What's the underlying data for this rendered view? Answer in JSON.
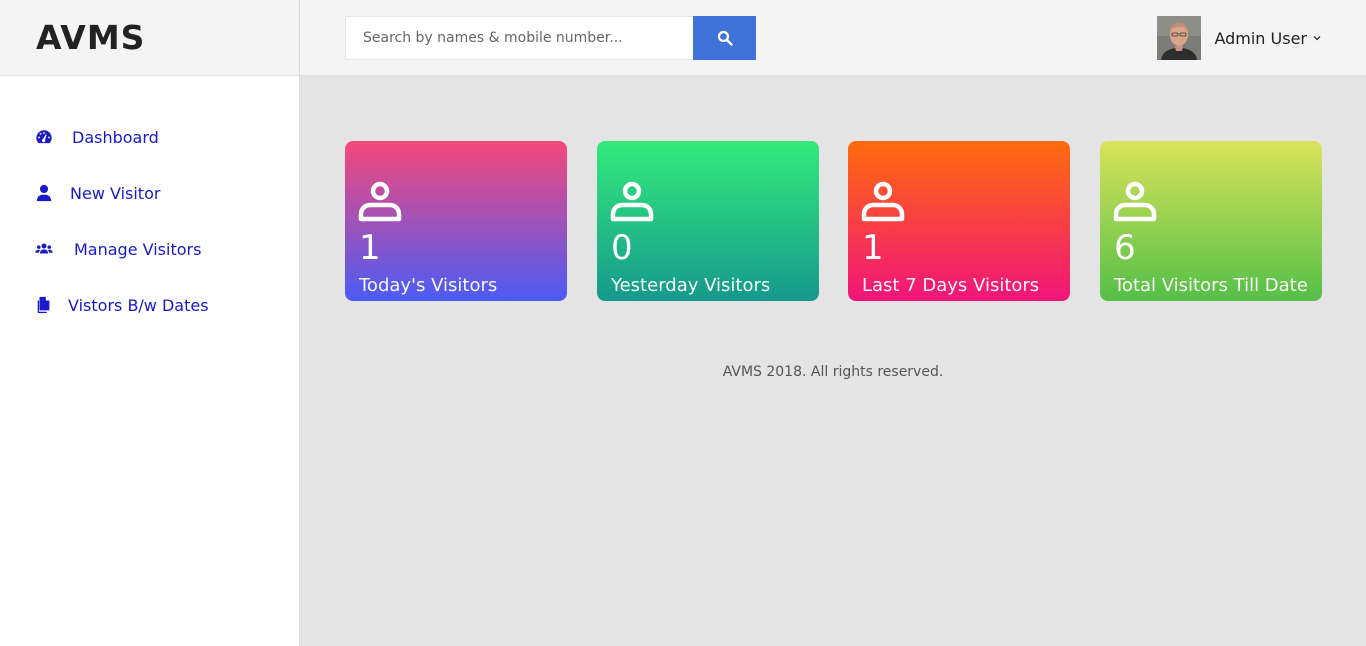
{
  "brand": "AVMS",
  "sidebar": {
    "items": [
      {
        "label": "Dashboard",
        "icon": "dashboard-gauge-icon"
      },
      {
        "label": "New Visitor",
        "icon": "user-icon"
      },
      {
        "label": "Manage Visitors",
        "icon": "users-group-icon"
      },
      {
        "label": "Vistors B/w Dates",
        "icon": "files-icon"
      }
    ]
  },
  "search": {
    "placeholder": "Search by names & mobile number...",
    "value": "",
    "button_icon": "search-icon"
  },
  "user": {
    "name": "Admin User",
    "avatar": "avatar-photo"
  },
  "cards": [
    {
      "count": "1",
      "label": "Today's Visitors",
      "colors": [
        "#f5487a",
        "#4b5cf5"
      ],
      "icon": "user-outline-icon"
    },
    {
      "count": "0",
      "label": "Yesterday Visitors",
      "colors": [
        "#33ea7c",
        "#16998d"
      ],
      "icon": "user-outline-icon"
    },
    {
      "count": "1",
      "label": "Last 7 Days Visitors",
      "colors": [
        "#ff6b0d",
        "#f0157a"
      ],
      "icon": "user-outline-icon"
    },
    {
      "count": "6",
      "label": "Total Visitors Till Date",
      "colors": [
        "#d9e35a",
        "#55bf48"
      ],
      "icon": "user-outline-icon"
    }
  ],
  "footer": "AVMS 2018. All rights reserved."
}
